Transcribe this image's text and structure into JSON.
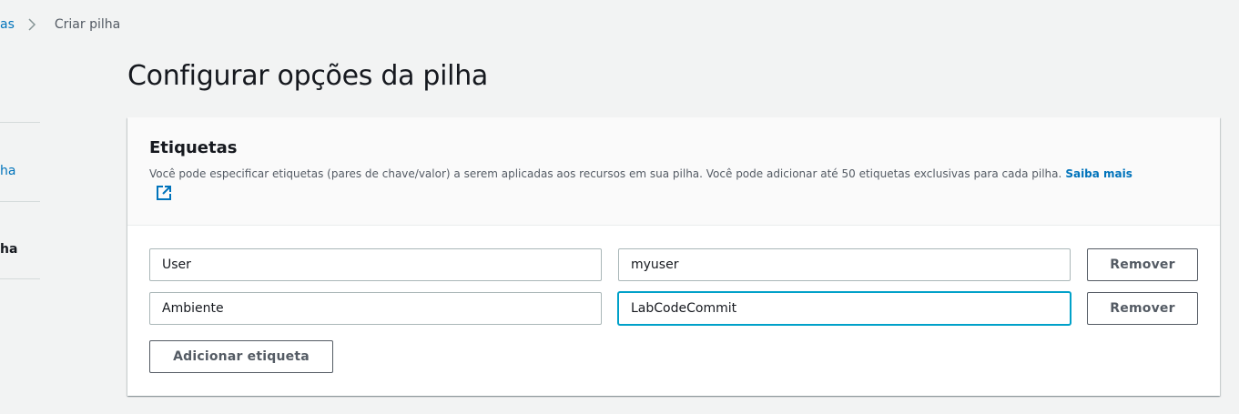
{
  "breadcrumb": {
    "parent_label": "as",
    "current_label": "Criar pilha"
  },
  "sidenav": {
    "item_link_label": "ha",
    "item_current_label": "ha"
  },
  "page_title": "Configurar opções da pilha",
  "tags_panel": {
    "title": "Etiquetas",
    "description": "Você pode especificar etiquetas (pares de chave/valor) a serem aplicadas aos recursos em sua pilha. Você pode adicionar até 50 etiquetas exclusivas para cada pilha.",
    "learn_more_label": "Saiba mais",
    "external_link_icon": "external-link-icon",
    "rows": [
      {
        "key": "User",
        "value": "myuser",
        "remove_label": "Remover"
      },
      {
        "key": "Ambiente",
        "value": "LabCodeCommit",
        "remove_label": "Remover"
      }
    ],
    "add_tag_label": "Adicionar etiqueta"
  },
  "colors": {
    "link": "#0073bb",
    "background": "#f2f3f3",
    "focus": "#00a1c9",
    "text": "#16191f",
    "secondary_text": "#545b64"
  }
}
